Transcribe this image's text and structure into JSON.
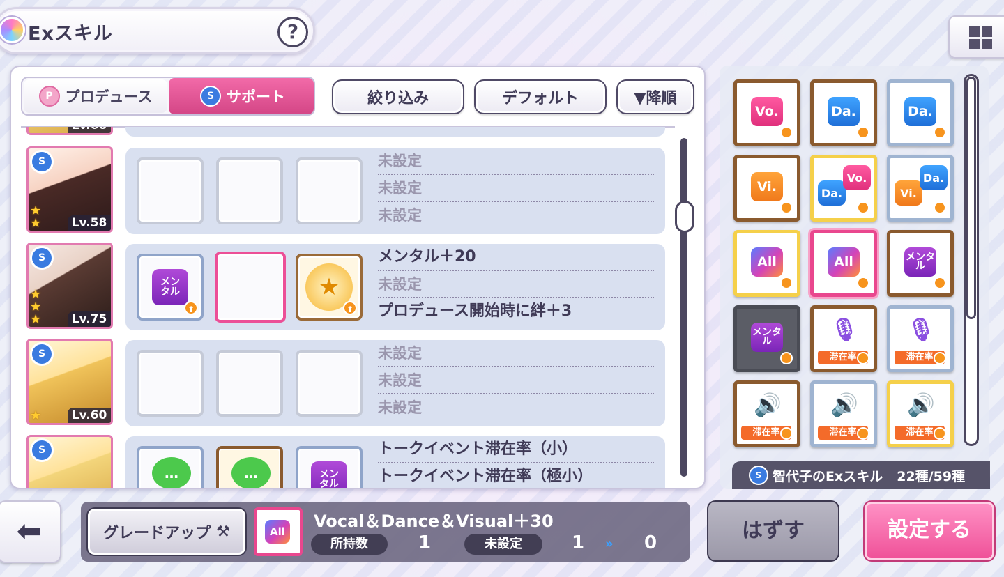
{
  "header": {
    "title": "Exスキル",
    "help_label": "?"
  },
  "tabs": {
    "produce_label": "プロデュース",
    "support_label": "サポート",
    "produce_icon": "P",
    "support_icon": "S"
  },
  "toolbar": {
    "filter_label": "絞り込み",
    "default_label": "デフォルト",
    "sort_label": "▼降順"
  },
  "list": {
    "top_partial_level": "Lv.60",
    "rows": [
      {
        "level": "Lv.58",
        "stars": 2,
        "slots": [
          "empty",
          "empty",
          "empty"
        ],
        "skills": [
          "未設定",
          "未設定",
          "未設定"
        ]
      },
      {
        "level": "Lv.75",
        "stars": 3,
        "slots": [
          "mental",
          "empty-selected",
          "bond"
        ],
        "skills": [
          "メンタル＋20",
          "未設定",
          "プロデュース開始時に絆＋3"
        ]
      },
      {
        "level": "Lv.60",
        "stars": 1,
        "slots": [
          "empty",
          "empty",
          "empty"
        ],
        "skills": [
          "未設定",
          "未設定",
          "未設定"
        ]
      },
      {
        "level": "",
        "stars": 0,
        "slots": [
          "talk",
          "talk",
          "mental"
        ],
        "skills": [
          "トークイベント滞在率（小）",
          "トークイベント滞在率（極小）"
        ]
      }
    ],
    "slot_icon_text": {
      "mental": "メン\nタル",
      "talk": "…"
    }
  },
  "skill_grid": {
    "tiles": [
      {
        "type": "vo",
        "label": "Vo.",
        "frame": "bronze"
      },
      {
        "type": "da",
        "label": "Da.",
        "frame": "bronze"
      },
      {
        "type": "da",
        "label": "Da.",
        "frame": "silver"
      },
      {
        "type": "vi",
        "label": "Vi.",
        "frame": "bronze"
      },
      {
        "type": "davo",
        "label": "Da. Vo.",
        "frame": "gold"
      },
      {
        "type": "vida",
        "label": "Vi. Da.",
        "frame": "silver"
      },
      {
        "type": "all",
        "label": "All",
        "frame": "gold"
      },
      {
        "type": "all",
        "label": "All",
        "frame": "selected"
      },
      {
        "type": "mental",
        "label": "メンタル",
        "frame": "bronze"
      },
      {
        "type": "mental",
        "label": "メンタル",
        "frame": "dark"
      },
      {
        "type": "mic",
        "label": "滞在率",
        "frame": "bronze"
      },
      {
        "type": "mic",
        "label": "滞在率",
        "frame": "silver"
      },
      {
        "type": "speaker",
        "label": "滞在率",
        "frame": "bronze"
      },
      {
        "type": "speaker",
        "label": "滞在率",
        "frame": "silver"
      },
      {
        "type": "speaker",
        "label": "滞在率",
        "frame": "gold"
      }
    ],
    "footer_label": "智代子のExスキル",
    "footer_count": "22種/59種"
  },
  "bottom": {
    "grade_up_label": "グレードアップ",
    "current_skill_name": "Vocal＆Dance＆Visual＋30",
    "current_icon_label": "All",
    "owned_label": "所持数",
    "owned_value": "1",
    "unset_label": "未設定",
    "unset_value": "1",
    "after_value": "0",
    "remove_label": "はずす",
    "set_label": "設定する"
  },
  "colors": {
    "accent_pink": "#ef4f97",
    "accent_blue": "#3a7be0"
  }
}
